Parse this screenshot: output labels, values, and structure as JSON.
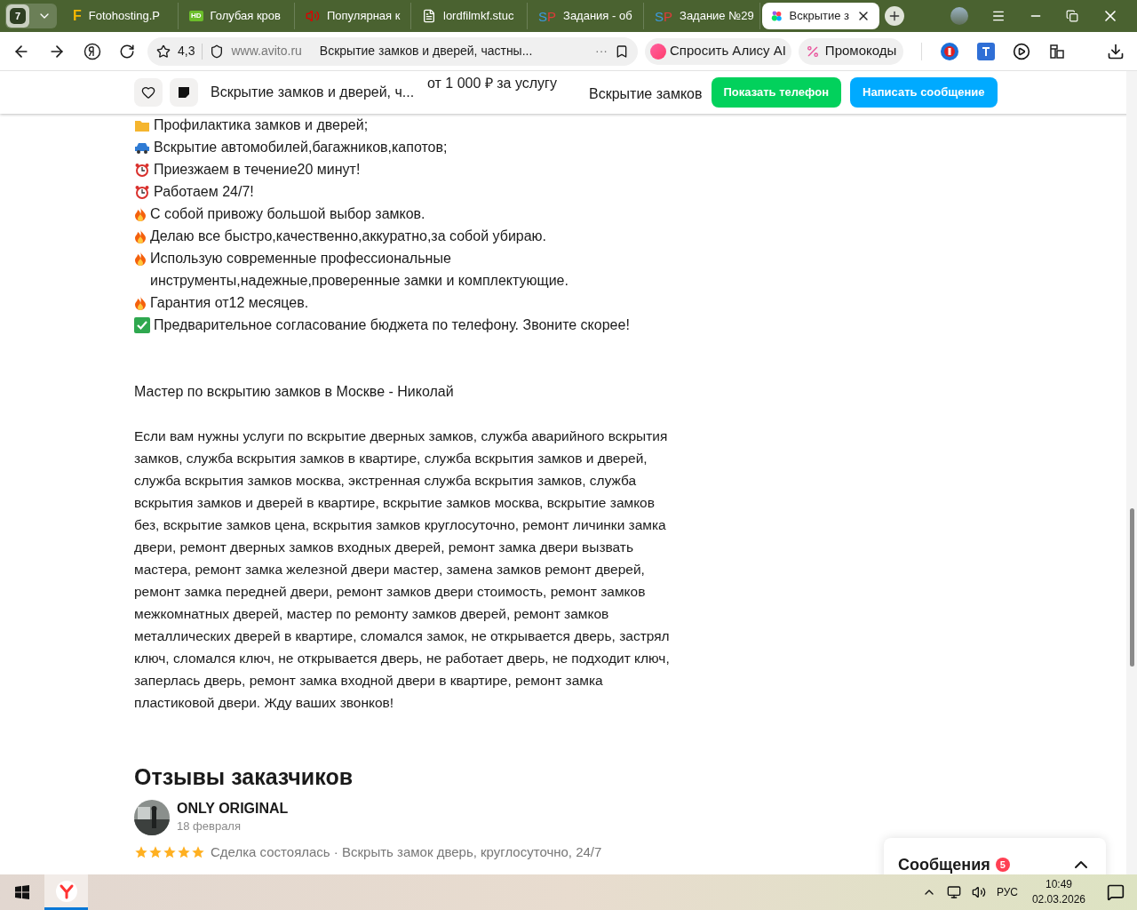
{
  "browser": {
    "tab_count": "7",
    "tabs": [
      {
        "title": "Fotohosting.P",
        "kind": "letter",
        "glyph": "F",
        "selected": false
      },
      {
        "title": "Голубая кров",
        "kind": "hd",
        "glyph": "HD",
        "selected": false
      },
      {
        "title": "Популярная к",
        "kind": "speaker",
        "selected": false
      },
      {
        "title": "lordfilmkf.stuc",
        "kind": "doc",
        "selected": false
      },
      {
        "title": "Задания - об",
        "kind": "sp",
        "glyph": "SP",
        "selected": false
      },
      {
        "title": "Задание №29",
        "kind": "sp",
        "glyph": "SP",
        "selected": false
      },
      {
        "title": "Вскрытие з",
        "kind": "dots",
        "selected": true
      }
    ],
    "address": {
      "rating": "4,3",
      "domain": "www.avito.ru",
      "page_title": "Вскрытие замков и дверей, частны...",
      "more": "···"
    },
    "alice": "Спросить Алису AI",
    "promo": "Промокоды"
  },
  "sticky_header": {
    "title": "Вскрытие замков и дверей, ч...",
    "price": "от 1 000 ₽ за услугу",
    "category": "Вскрытие замков",
    "show_phone": "Показать телефон",
    "write_message": "Написать сообщение"
  },
  "description_lines": [
    {
      "kind": "folder",
      "text": "Профилактика замков и дверей;"
    },
    {
      "kind": "car",
      "text": "Вскрытие автомобилей,багажников,капотов;"
    },
    {
      "kind": "clock",
      "text": "Приезжаем в течение20 минут!"
    },
    {
      "kind": "clock",
      "text": "Работаем 24/7!"
    },
    {
      "kind": "fire",
      "text": "С собой привожу большой выбор замков."
    },
    {
      "kind": "fire",
      "text": "Делаю все быстро,качественно,аккуратно,за собой убираю."
    },
    {
      "kind": "fire",
      "text": "Использую современные профессиональные инструменты,надежные,проверенные замки и комплектующие."
    },
    {
      "kind": "fire",
      "text": "Гарантия от12 месяцев."
    },
    {
      "kind": "check",
      "text": "Предварительное согласование бюджета по телефону. Звоните скорее!"
    }
  ],
  "master_line": "Мастер по вскрытию замков в Москве - Николай",
  "paragraph": "Если вам нужны услуги по вскрытие дверных замков, служба аварийного вскрытия замков, служба вскрытия замков в квартире, служба вскрытия замков и дверей, служба вскрытия замков москва, экстренная служба вскрытия замков, служба вскрытия замков и дверей в квартире, вскрытие замков москва, вскрытие замков без, вскрытие замков цена, вскрытия замков круглосуточно, ремонт личинки замка двери, ремонт дверных замков входных дверей, ремонт замка двери вызвать мастера, ремонт замка железной двери мастер, замена замков ремонт дверей, ремонт замка передней двери, ремонт замков двери стоимость, ремонт замков межкомнатных дверей, мастер по ремонту замков дверей, ремонт замков металлических дверей в квартире, сломался замок, не открывается дверь, застрял ключ, сломался ключ, не открывается дверь, не работает дверь, не подходит ключ, заперлась дверь, ремонт замка входной двери в квартире, ремонт замка пластиковой двери. Жду ваших звонков!",
  "reviews": {
    "heading": "Отзывы заказчиков",
    "items": [
      {
        "name": "ONLY ORIGINAL",
        "date": "18 февраля",
        "stars": 5,
        "summary": "Сделка состоялась · Вскрыть замок дверь, круглосуточно, 24/7"
      }
    ]
  },
  "messages_panel": {
    "title": "Сообщения",
    "count": "5",
    "expanded": false
  },
  "taskbar": {
    "language": "РУС",
    "time": "10:49",
    "date": "02.03.2026"
  }
}
